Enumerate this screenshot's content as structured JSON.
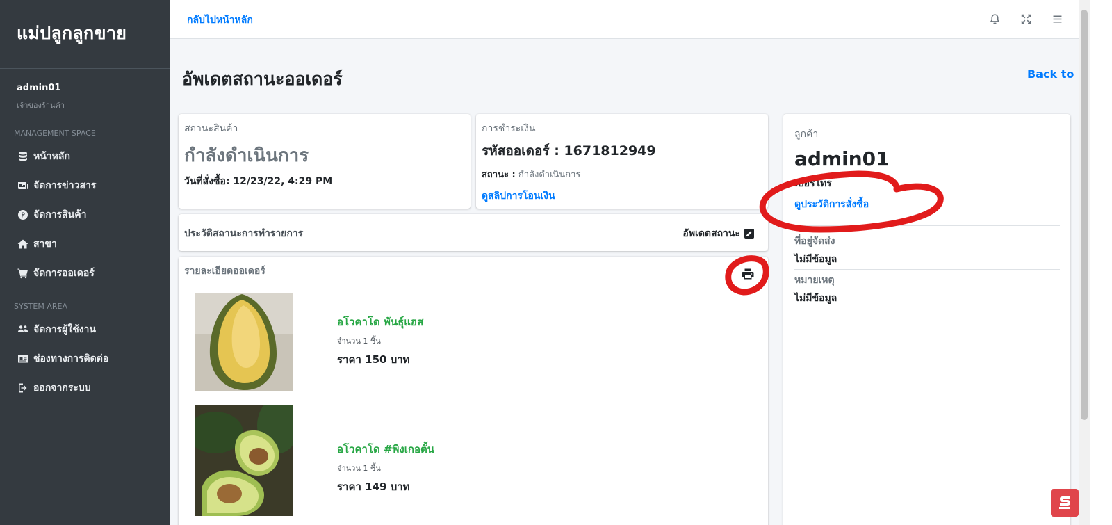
{
  "sidebar": {
    "brand": "แม่ปลูกลูกขาย",
    "user": {
      "name": "admin01",
      "role": "เจ้าของร้านค้า"
    },
    "sections": [
      {
        "header": "MANAGEMENT SPACE",
        "items": [
          {
            "label": "หน้าหลัก",
            "icon": "database-icon"
          },
          {
            "label": "จัดการข่าวสาร",
            "icon": "newspaper-icon"
          },
          {
            "label": "จัดการสินค้า",
            "icon": "product-coin-icon"
          },
          {
            "label": "สาขา",
            "icon": "home-icon"
          },
          {
            "label": "จัดการออเดอร์",
            "icon": "cart-icon"
          }
        ]
      },
      {
        "header": "SYSTEM AREA",
        "items": [
          {
            "label": "จัดการผู้ใช้งาน",
            "icon": "users-icon"
          },
          {
            "label": "ช่องทางการติดต่อ",
            "icon": "contact-card-icon"
          },
          {
            "label": "ออกจากระบบ",
            "icon": "logout-icon"
          }
        ]
      }
    ]
  },
  "topbar": {
    "home_link": "กลับไปหน้าหลัก",
    "icons": [
      "bell-icon",
      "fullscreen-icon",
      "menu-icon"
    ]
  },
  "page": {
    "title": "อัพเดตสถานะออเดอร์",
    "back_label": "Back to"
  },
  "product_status": {
    "label": "สถานะสินค้า",
    "status": "กำลังดำเนินการ",
    "order_date": "วันที่สั่งซื้อ: 12/23/22, 4:29 PM"
  },
  "payment": {
    "label": "การชำระเงิน",
    "order_code": "รหัสออเดอร์ : 1671812949",
    "status_label": "สถานะ :",
    "status_value": "กำลังดำเนินการ",
    "slip_link": "ดูสลิปการโอนเงิน"
  },
  "history": {
    "title": "ประวัติสถานะการทำรายการ",
    "update_label": "อัพเดตสถานะ"
  },
  "order_detail": {
    "title": "รายละเอียดออเดอร์",
    "products": [
      {
        "name": "อโวคาโด พันธุ์แฮส",
        "qty": "จำนวน 1 ชิ้น",
        "price": "ราคา 150 บาท"
      },
      {
        "name": "อโวคาโด #พิงเกอตั้น",
        "qty": "จำนวน 1 ชิ้น",
        "price": "ราคา 149 บาท"
      }
    ]
  },
  "customer": {
    "label": "ลูกค้า",
    "name": "admin01",
    "phone": "เบอร์โทร",
    "history_link": "ดูประวัติการสั่งซื้อ",
    "address_label": "ที่อยู่จัดส่ง",
    "address_value": "ไม่มีข้อมูล",
    "note_label": "หมายเหตุ",
    "note_value": "ไม่มีข้อมูล"
  },
  "colors": {
    "sidebar_bg": "#343a40",
    "link": "#007bff",
    "product_name": "#28a745",
    "annotation_red": "#e11b1b"
  }
}
